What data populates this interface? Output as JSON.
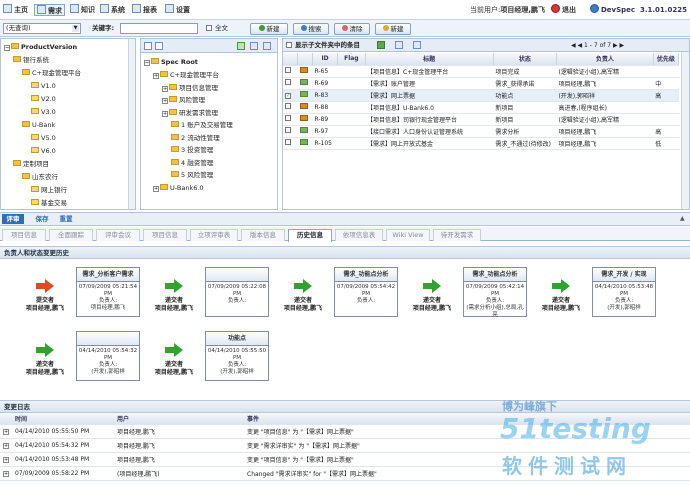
{
  "topbar": {
    "items": [
      "主页",
      "需求",
      "知识",
      "系统",
      "报表",
      "设置"
    ],
    "user_prefix": "当前用户:",
    "user": "项目经理,鹏飞",
    "logout": "退出",
    "product": "DevSpec",
    "version": "3.1.01.0225"
  },
  "search": {
    "query_select": "(无查询)",
    "keyword_label": "关键字:",
    "keyword_value": "",
    "fulltext_label": "全文",
    "new_btn": "新建",
    "search_btn": "搜索",
    "clear_btn": "清除",
    "create_btn": "新建"
  },
  "product_tree": {
    "root": "ProductVersion",
    "items": [
      {
        "label": "银行系统",
        "level": 1
      },
      {
        "label": "C+现金管理平台",
        "level": 2
      },
      {
        "label": "V1.0",
        "level": 3
      },
      {
        "label": "V2.0",
        "level": 3
      },
      {
        "label": "V3.0",
        "level": 3
      },
      {
        "label": "U-Bank",
        "level": 2
      },
      {
        "label": "V5.0",
        "level": 3
      },
      {
        "label": "V6.0",
        "level": 3
      },
      {
        "label": "定制项目",
        "level": 1
      },
      {
        "label": "山东农行",
        "level": 2
      },
      {
        "label": "网上银行",
        "level": 3
      },
      {
        "label": "基金交易",
        "level": 3
      }
    ]
  },
  "spec_tree": {
    "root": "Spec Root",
    "items": [
      {
        "label": "C+现金管理平台",
        "level": 1
      },
      {
        "label": "项目信息管理",
        "level": 2
      },
      {
        "label": "风险管理",
        "level": 2
      },
      {
        "label": "研发需求管理",
        "level": 2
      },
      {
        "label": "1 账户及交易管理",
        "level": 3
      },
      {
        "label": "2 流动性管理",
        "level": 3
      },
      {
        "label": "3 投资管理",
        "level": 3
      },
      {
        "label": "4 融资管理",
        "level": 3
      },
      {
        "label": "5 风险管理",
        "level": 3
      },
      {
        "label": "U-Bank6.0",
        "level": 1
      }
    ]
  },
  "req_list": {
    "show_sub_label": "显示子文件夹中的条目",
    "pager": "1 - 7 of 7",
    "columns": [
      "ID",
      "Flag",
      "标题",
      "状态",
      "负责人",
      "优先级"
    ],
    "rows": [
      {
        "id": "R-65",
        "title": "【项目信息】C+现金管理平台",
        "status": "项目完成",
        "owner": "(逻辑验证小组),高军精",
        "prio": "",
        "checked": false,
        "icon": "b"
      },
      {
        "id": "R-69",
        "title": "【需求】账户管理",
        "status": "需求_获得承诺",
        "owner": "项目经理,鹏飞",
        "prio": "中",
        "checked": false,
        "icon": "g"
      },
      {
        "id": "R-83",
        "title": "【需求】网上票据",
        "status": "功能点",
        "owner": "(开发),郭昭祥",
        "prio": "高",
        "checked": true,
        "icon": "g"
      },
      {
        "id": "R-88",
        "title": "【项目信息】U-Bank6.0",
        "status": "新项目",
        "owner": "高进春,(程序组长)",
        "prio": "",
        "checked": false,
        "icon": "b"
      },
      {
        "id": "R-89",
        "title": "【项目信息】司银行现金管理平台",
        "status": "新项目",
        "owner": "(逻辑验证小组),高军精",
        "prio": "",
        "checked": false,
        "icon": "b"
      },
      {
        "id": "R-97",
        "title": "【接口需求】人口身份认证管理系统",
        "status": "需求分析",
        "owner": "项目经理,鹏飞",
        "prio": "高",
        "checked": false,
        "icon": "g"
      },
      {
        "id": "R-105",
        "title": "【需求】网上开放式基金",
        "status": "需求_不通过(待修改)",
        "owner": "项目经理,鹏飞",
        "prio": "低",
        "checked": false,
        "icon": "g"
      }
    ]
  },
  "actions": {
    "review": "评审",
    "save": "保存",
    "cancel": "重置"
  },
  "tabs": [
    "项目信息",
    "全面跟踪",
    "评审会议",
    "项目信息",
    "立项评审表",
    "版本信息",
    "历史信息",
    "依项信息表",
    "Wiki View",
    "待开发需求"
  ],
  "active_tab": 6,
  "flow": {
    "title": "负责人和状态变更历史",
    "row1": [
      {
        "arrow": "red",
        "action": "提交者",
        "who": "项目经理,鹏飞",
        "node_title": "需求_分析客户需求",
        "date": "07/09/2009 05:21:54 PM",
        "owner_label": "负责人:",
        "owner": "项目经理,鹏飞"
      },
      {
        "arrow": "green",
        "action": "递交者",
        "who": "项目经理,鹏飞",
        "node_title": "",
        "date": "07/09/2009 05:22:08 PM",
        "owner_label": "负责人:",
        "owner": ""
      },
      {
        "arrow": "green",
        "action": "递交者",
        "who": "项目经理,鹏飞",
        "node_title": "需求_功能点分析",
        "date": "07/09/2009 05:54:42 PM",
        "owner_label": "负责人:",
        "owner": ""
      },
      {
        "arrow": "green",
        "action": "递交者",
        "who": "项目经理,鹏飞",
        "node_title": "需求_功能点分析",
        "date": "07/09/2009 05:42:14 PM",
        "owner_label": "负责人:",
        "owner": "(需求分析小组),总局,孔亮"
      },
      {
        "arrow": "green",
        "action": "递交者",
        "who": "项目经理,鹏飞",
        "node_title": "需求_开发 / 实现",
        "date": "04/14/2010 05:53:48 PM",
        "owner_label": "负责人:",
        "owner": "(开发),郭昭祥"
      }
    ],
    "row2": [
      {
        "arrow": "green",
        "action": "递交者",
        "who": "项目经理,鹏飞",
        "node_title": "",
        "date": "04/14/2010 05:54:32 PM",
        "owner_label": "负责人:",
        "owner": "(开发),郭昭祥"
      },
      {
        "arrow": "green",
        "action": "递交者",
        "who": "项目经理,鹏飞",
        "node_title": "功能点",
        "date": "04/14/2010 05:55:50 PM",
        "owner_label": "负责人:",
        "owner": "(开发),郭昭祥"
      }
    ]
  },
  "log": {
    "title": "变更日志",
    "columns": [
      "时间",
      "用户",
      "事件"
    ],
    "rows": [
      {
        "time": "04/14/2010 05:55:50 PM",
        "user": "项目经理,鹏飞",
        "event": "变更 \"项目信息\" 为 \"【需求】网上票据\""
      },
      {
        "time": "04/14/2010 05:54:32 PM",
        "user": "项目经理,鹏飞",
        "event": "变更 \"需求详审实\" 为 \"【需求】网上票据\""
      },
      {
        "time": "04/14/2010 05:53:48 PM",
        "user": "项目经理,鹏飞",
        "event": "变更 \"项目信息\" 为 \"【需求】网上票据\""
      },
      {
        "time": "07/09/2009 05:58:22 PM",
        "user": "(项目经理,鹏飞)",
        "event": "Changed \"需求详审实\" for \"【需求】网上票据\""
      }
    ]
  },
  "watermark": {
    "line1": "博为峰旗下",
    "line2": "51testing",
    "line3": "软件测试网"
  }
}
